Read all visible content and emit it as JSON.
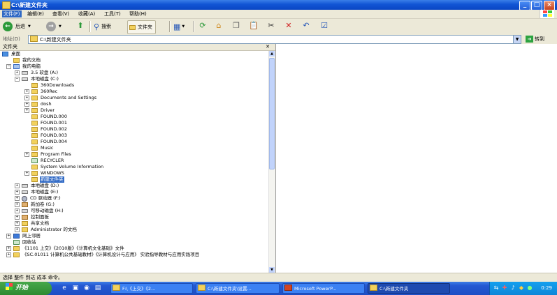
{
  "window": {
    "title": "C:\\新建文件夹"
  },
  "menu": [
    "文件(F)",
    "编辑(E)",
    "查看(V)",
    "收藏(A)",
    "工具(T)",
    "帮助(H)"
  ],
  "toolbar": {
    "back_label": "后退",
    "search_label": "搜索",
    "folders_label": "文件夹"
  },
  "address": {
    "label": "地址(D)",
    "value": "C:\\新建文件夹",
    "go_label": "转到"
  },
  "folders_pane": {
    "title": "文件夹",
    "items": [
      "桌面",
      "我的文档",
      "我的电脑",
      "3.5 软盘 (A:)",
      "本地磁盘 (C:)",
      "360Downloads",
      "360Rec",
      "Documents and Settings",
      "dosh",
      "Driver",
      "FOUND.000",
      "FOUND.001",
      "FOUND.002",
      "FOUND.003",
      "FOUND.004",
      "Music",
      "Program Files",
      "RECYCLER",
      "System Volume Information",
      "WINDOWS",
      "新建文件夹",
      "本地磁盘 (D:)",
      "本地磁盘 (E:)",
      "CD 驱动器 (F:)",
      "新加卷 (G:)",
      "可移动磁盘 (H:)",
      "控制面板",
      "共享文档",
      "Administrator 的文档",
      "网上邻居",
      "回收站",
      "《1101 上交》《2010版》《计算机文化基础》文件",
      "《SC.01011 计算机公共基础教材》《计算机设计与应用》 实验指导教材与应用实践项目"
    ]
  },
  "statusbar": {
    "text": "选择 整件 到达 成本 命令。"
  },
  "taskbar": {
    "start_label": "开始",
    "tasks": [
      "F:\\《上交》《2...",
      "C:\\新建文件夹\\设置...",
      "Microsoft PowerP...",
      "C:\\新建文件夹"
    ],
    "clock": "0:29"
  }
}
